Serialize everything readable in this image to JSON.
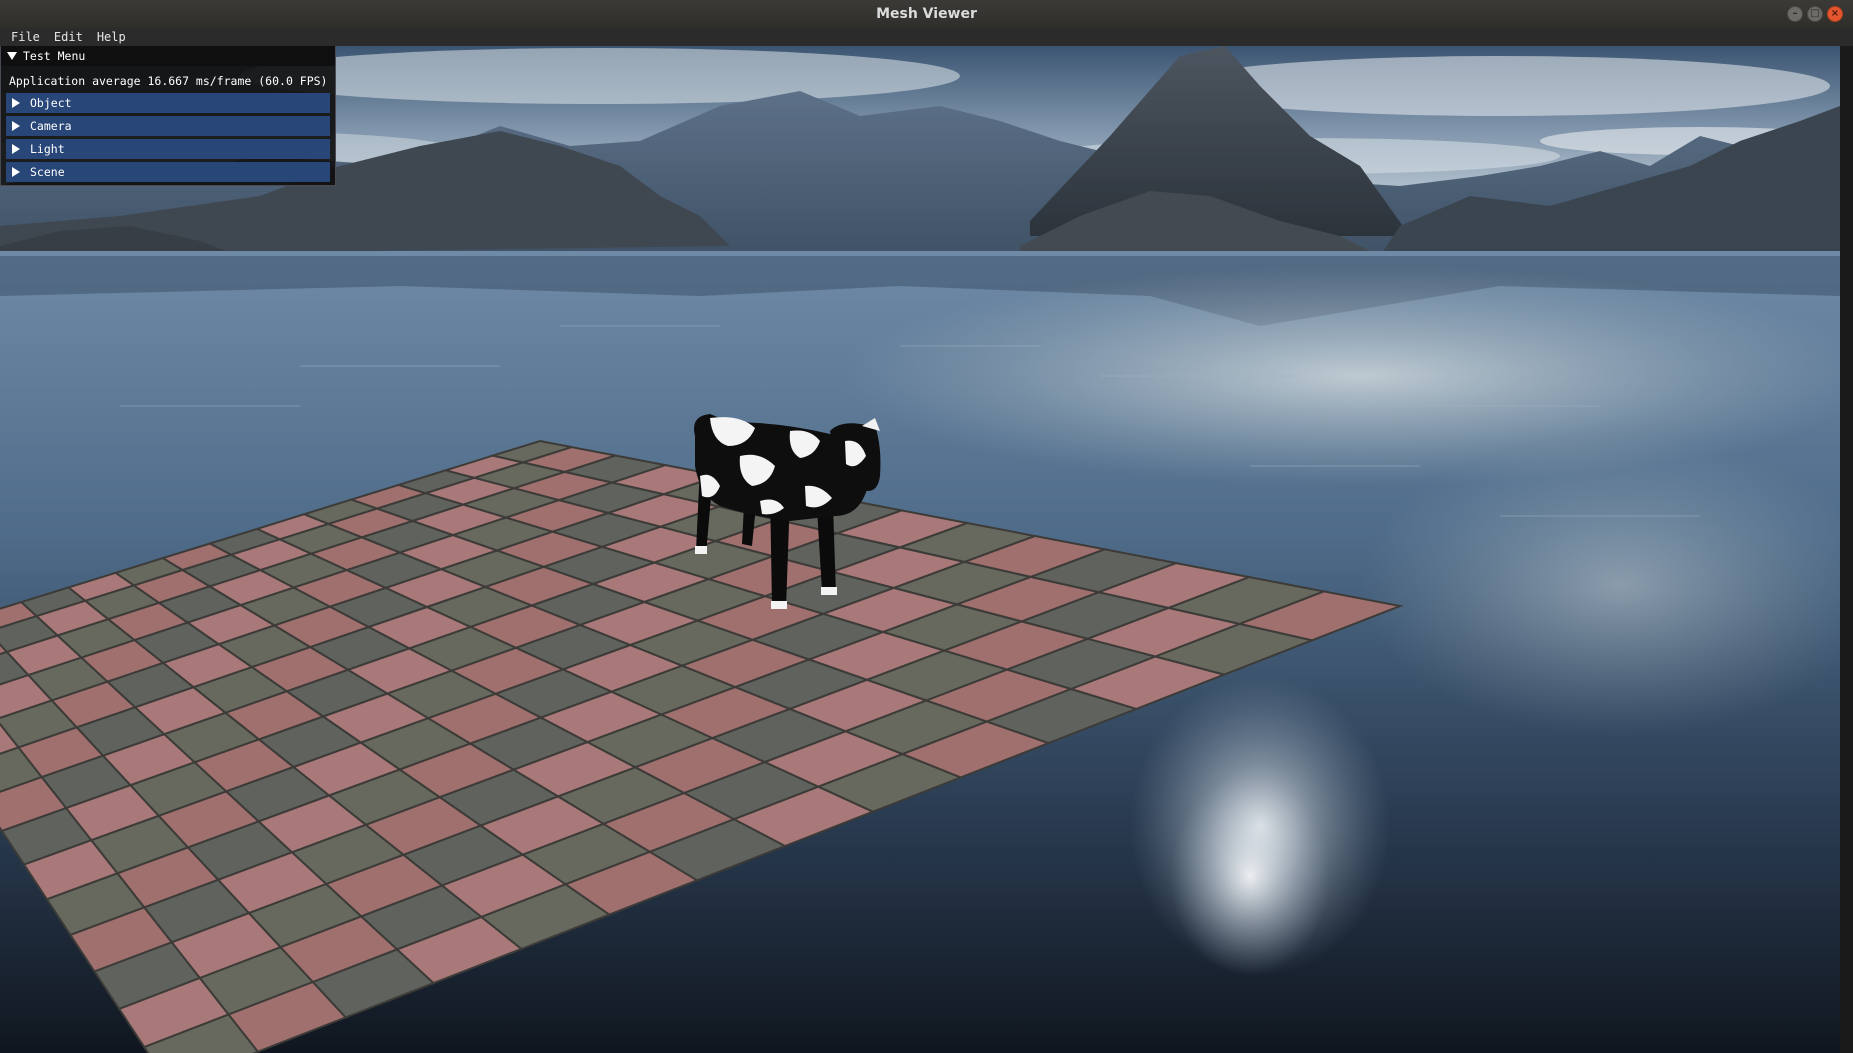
{
  "window": {
    "title": "Mesh Viewer"
  },
  "menubar": {
    "items": [
      "File",
      "Edit",
      "Help"
    ]
  },
  "imgui": {
    "window_title": "Test Menu",
    "perf_text": "Application average 16.667 ms/frame (60.0 FPS)",
    "headers": [
      "Object",
      "Camera",
      "Light",
      "Scene"
    ]
  },
  "colors": {
    "header_bg": "#284677",
    "close_button": "#e3562f",
    "titlebar_bg": "#2f2e2b"
  }
}
